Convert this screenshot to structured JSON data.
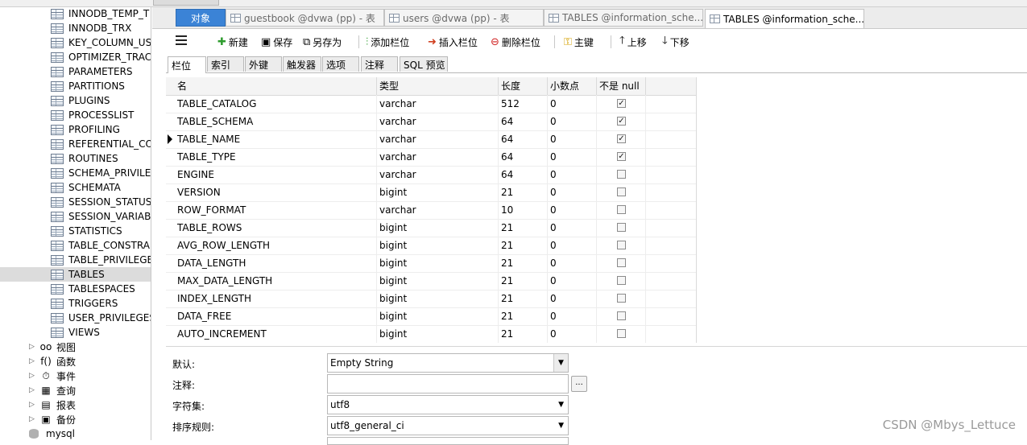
{
  "sidebar": {
    "tables": [
      {
        "label": "INNODB_TEMP_T",
        "selected": false
      },
      {
        "label": "INNODB_TRX",
        "selected": false
      },
      {
        "label": "KEY_COLUMN_US",
        "selected": false
      },
      {
        "label": "OPTIMIZER_TRAC",
        "selected": false
      },
      {
        "label": "PARAMETERS",
        "selected": false
      },
      {
        "label": "PARTITIONS",
        "selected": false
      },
      {
        "label": "PLUGINS",
        "selected": false
      },
      {
        "label": "PROCESSLIST",
        "selected": false
      },
      {
        "label": "PROFILING",
        "selected": false
      },
      {
        "label": "REFERENTIAL_CO",
        "selected": false
      },
      {
        "label": "ROUTINES",
        "selected": false
      },
      {
        "label": "SCHEMA_PRIVILE",
        "selected": false
      },
      {
        "label": "SCHEMATA",
        "selected": false
      },
      {
        "label": "SESSION_STATUS",
        "selected": false
      },
      {
        "label": "SESSION_VARIAB",
        "selected": false
      },
      {
        "label": "STATISTICS",
        "selected": false
      },
      {
        "label": "TABLE_CONSTRAI",
        "selected": false
      },
      {
        "label": "TABLE_PRIVILEGE",
        "selected": false
      },
      {
        "label": "TABLES",
        "selected": true
      },
      {
        "label": "TABLESPACES",
        "selected": false
      },
      {
        "label": "TRIGGERS",
        "selected": false
      },
      {
        "label": "USER_PRIVILEGES",
        "selected": false
      },
      {
        "label": "VIEWS",
        "selected": false
      }
    ],
    "groups": [
      {
        "label": "视图",
        "icon": "oo"
      },
      {
        "label": "函数",
        "icon": "f()"
      },
      {
        "label": "事件",
        "icon": "⏱"
      },
      {
        "label": "查询",
        "icon": "▦"
      },
      {
        "label": "报表",
        "icon": "▤"
      },
      {
        "label": "备份",
        "icon": "▣"
      }
    ],
    "db": "mysql"
  },
  "tabs": [
    {
      "label": "对象"
    },
    {
      "label": "guestbook @dvwa (pp) - 表"
    },
    {
      "label": "users @dvwa (pp) - 表"
    },
    {
      "label": "TABLES @information_sche..."
    },
    {
      "label": "TABLES @information_sche..."
    }
  ],
  "toolbar": {
    "new": "新建",
    "save": "保存",
    "save_as": "另存为",
    "add_field": "添加栏位",
    "insert_field": "插入栏位",
    "delete_field": "删除栏位",
    "primary_key": "主键",
    "move_up": "上移",
    "move_down": "下移"
  },
  "subtabs": [
    "栏位",
    "索引",
    "外键",
    "触发器",
    "选项",
    "注释",
    "SQL 预览"
  ],
  "grid": {
    "headers": {
      "name": "名",
      "type": "类型",
      "length": "长度",
      "decimals": "小数点",
      "not_null": "不是 null"
    },
    "rows": [
      {
        "name": "TABLE_CATALOG",
        "type": "varchar",
        "length": "512",
        "decimals": "0",
        "not_null": true
      },
      {
        "name": "TABLE_SCHEMA",
        "type": "varchar",
        "length": "64",
        "decimals": "0",
        "not_null": true
      },
      {
        "name": "TABLE_NAME",
        "type": "varchar",
        "length": "64",
        "decimals": "0",
        "not_null": true
      },
      {
        "name": "TABLE_TYPE",
        "type": "varchar",
        "length": "64",
        "decimals": "0",
        "not_null": true
      },
      {
        "name": "ENGINE",
        "type": "varchar",
        "length": "64",
        "decimals": "0",
        "not_null": false
      },
      {
        "name": "VERSION",
        "type": "bigint",
        "length": "21",
        "decimals": "0",
        "not_null": false
      },
      {
        "name": "ROW_FORMAT",
        "type": "varchar",
        "length": "10",
        "decimals": "0",
        "not_null": false
      },
      {
        "name": "TABLE_ROWS",
        "type": "bigint",
        "length": "21",
        "decimals": "0",
        "not_null": false
      },
      {
        "name": "AVG_ROW_LENGTH",
        "type": "bigint",
        "length": "21",
        "decimals": "0",
        "not_null": false
      },
      {
        "name": "DATA_LENGTH",
        "type": "bigint",
        "length": "21",
        "decimals": "0",
        "not_null": false
      },
      {
        "name": "MAX_DATA_LENGTH",
        "type": "bigint",
        "length": "21",
        "decimals": "0",
        "not_null": false
      },
      {
        "name": "INDEX_LENGTH",
        "type": "bigint",
        "length": "21",
        "decimals": "0",
        "not_null": false
      },
      {
        "name": "DATA_FREE",
        "type": "bigint",
        "length": "21",
        "decimals": "0",
        "not_null": false
      },
      {
        "name": "AUTO_INCREMENT",
        "type": "bigint",
        "length": "21",
        "decimals": "0",
        "not_null": false
      }
    ]
  },
  "props": {
    "default_label": "默认:",
    "default_value": "Empty String",
    "comment_label": "注释:",
    "comment_value": "",
    "comment_btn": "...",
    "charset_label": "字符集:",
    "charset_value": "utf8",
    "collation_label": "排序规则:",
    "collation_value": "utf8_general_ci"
  },
  "watermark": "CSDN @Mbys_Lettuce"
}
